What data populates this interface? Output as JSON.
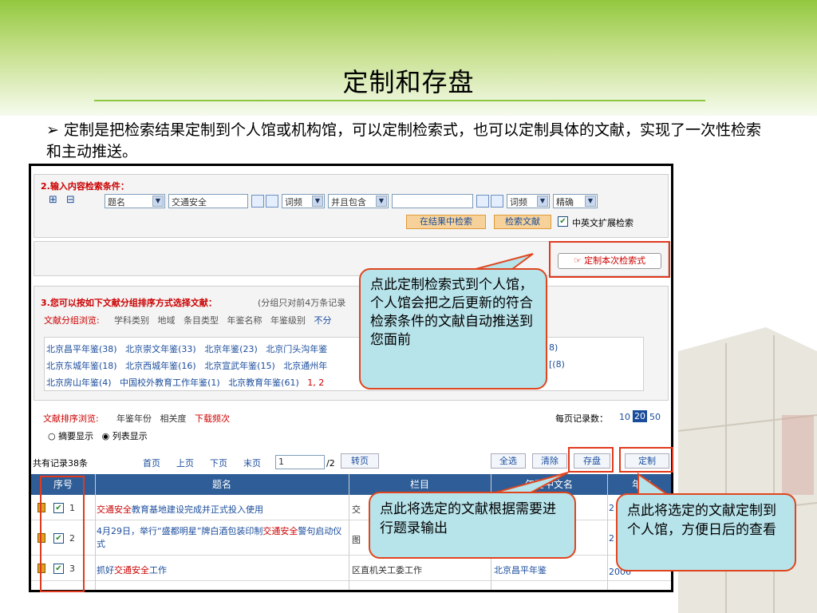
{
  "slide": {
    "title": "定制和存盘",
    "bullet": "➢ 定制是把检索结果定制到个人馆或机构馆，可以定制检索式，也可以定制具体的文献，实现了一次性检索和主动推送。"
  },
  "search": {
    "heading": "2.输入内容检索条件：",
    "expand": "⊞",
    "collapse": "⊟",
    "field1": "题名",
    "query1": "交通安全",
    "freq1": "词频",
    "logic": "并且包含",
    "query2": "",
    "freq2": "词频",
    "match": "精确",
    "btn_in_results": "在结果中检索",
    "btn_search": "检索文献",
    "cn_en_label": "中英文扩展检索",
    "btn_custom_query": "定制本次检索式"
  },
  "grouping": {
    "heading": "3.您可以按如下文献分组排序方式选择文献：",
    "note": "(分组只对前4万条记录",
    "browse_label": "文献分组浏览:",
    "groups": [
      "学科类别",
      "地域",
      "条目类型",
      "年鉴名称",
      "年鉴级别",
      "不分"
    ],
    "links_row1": [
      "北京昌平年鉴(38)",
      "北京崇文年鉴(33)",
      "北京年鉴(23)",
      "北京门头沟年鉴"
    ],
    "links_row1_tail": "8)",
    "links_row2": [
      "北京东城年鉴(18)",
      "北京西城年鉴(16)",
      "北京宣武年鉴(15)",
      "北京通州年"
    ],
    "links_row2_tail": "[(8)",
    "links_row3": [
      "北京房山年鉴(4)",
      "中国校外教育工作年鉴(1)",
      "北京教育年鉴(61)"
    ],
    "links_row3_tail": "1, 2"
  },
  "sort": {
    "label": "文献排序浏览:",
    "options": [
      "年鉴年份",
      "相关度",
      "下载频次"
    ],
    "per_page_label": "每页记录数：",
    "per_page": [
      "10",
      "20",
      "50"
    ],
    "view_abstract": "摘要显示",
    "view_list": "列表显示"
  },
  "pager": {
    "total": "共有记录38条",
    "first": "首页",
    "prev": "上页",
    "next": "下页",
    "last": "末页",
    "page_value": "1",
    "page_total": "/2",
    "go": "转页",
    "select_all": "全选",
    "clear": "清除",
    "save": "存盘",
    "customize": "定制"
  },
  "table": {
    "headers": [
      "序号",
      "题名",
      "栏目",
      "年鉴中文名",
      "年鉴"
    ],
    "rows": [
      {
        "num": "1",
        "title_hl": "交通安全",
        "title_rest": "教育基地建设完成并正式投入使用",
        "column": "交",
        "yearbook": "",
        "year": "2"
      },
      {
        "num": "2",
        "title_pre": "4月29日，举行“盛都明星”牌白酒包装印制",
        "title_hl": "交通安全",
        "title_rest": "警句启动仪式",
        "column": "图",
        "yearbook": "",
        "year": "2"
      },
      {
        "num": "3",
        "title_pre": "抓好",
        "title_hl": "交通安全",
        "title_rest": "工作",
        "column": "区直机关工委工作",
        "yearbook": "北京昌平年鉴",
        "year": "2006"
      }
    ]
  },
  "callouts": {
    "custom_query": "点此定制检索式到个人馆，个人馆会把之后更新的符合检索条件的文献自动推送到您面前",
    "save": "点此将选定的文献根据需要进行题录输出",
    "customize": "点此将选定的文献定制到个人馆，方便日后的查看"
  }
}
